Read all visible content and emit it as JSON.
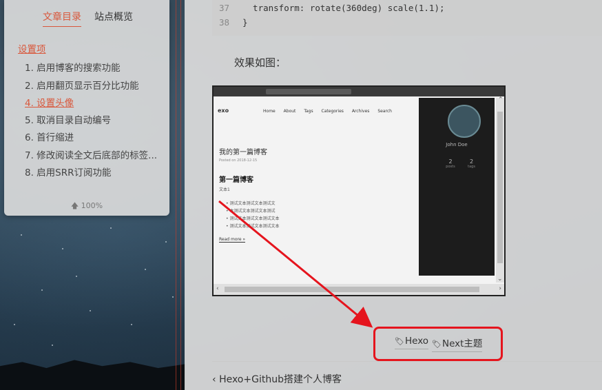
{
  "sidebar": {
    "tabs": [
      {
        "label": "文章目录",
        "active": true
      },
      {
        "label": "站点概览",
        "active": false
      }
    ],
    "toc": {
      "parent": "设置项",
      "items": [
        "1. 启用博客的搜索功能",
        "2. 启用翻页显示百分比功能",
        "4. 设置头像",
        "5. 取消目录自动编号",
        "6. 首行缩进",
        "7. 修改阅读全文后底部的标签...",
        "8. 启用SRR订阅功能"
      ],
      "active_index": 2
    },
    "progress": "100%"
  },
  "main": {
    "code": [
      {
        "ln": "37",
        "text": "  transform: rotate(360deg) scale(1.1);"
      },
      {
        "ln": "38",
        "text": "}"
      }
    ],
    "effect_text": "效果如图：",
    "embedded_screenshot": {
      "brand": "exo",
      "nav": [
        "Home",
        "About",
        "Tags",
        "Categories",
        "Archives",
        "Search"
      ],
      "post_title": "我的第一篇博客",
      "post_date": "Posted on 2018-12-15",
      "heading": "第一篇博客",
      "sub": "文本1",
      "bullets": [
        "测试文本测试文本测试文",
        "本测试文本测试文本测试",
        "测试文本测试文本测试文本",
        "测试文本测试文本测试文本"
      ],
      "read_more": "Read more »",
      "author": "John Doe",
      "stats": [
        {
          "value": "2",
          "label": "posts"
        },
        {
          "value": "2",
          "label": "tags"
        }
      ]
    },
    "tags": [
      "Hexo",
      "Next主题"
    ],
    "prev_post": "Hexo+Github搭建个人博客"
  },
  "colors": {
    "accent": "#d9573b",
    "highlight_box": "#e5141d"
  }
}
